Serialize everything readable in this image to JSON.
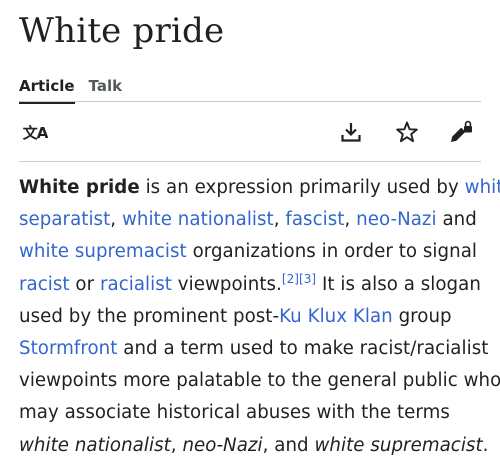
{
  "title": "White pride",
  "tabs": {
    "article": "Article",
    "talk": "Talk"
  },
  "colors": {
    "link": "#3366cc",
    "text": "#202122",
    "divider": "#c8ccd1"
  },
  "icons": [
    "language-icon",
    "download-icon",
    "star-icon",
    "edit-lock-icon"
  ],
  "language_glyph": "文A",
  "paragraph": {
    "bold_term": "White pride",
    "t1": " is an expression primarily used by ",
    "l_white_separatist_a": "white",
    "l_white_separatist_b": "separatist",
    "t2": ", ",
    "l_white_nationalist": "white nationalist",
    "t3": ", ",
    "l_fascist": "fascist",
    "t4": ", ",
    "l_neo_nazi": "neo-Nazi",
    "t5": " and",
    "l_white_supremacist": "white supremacist",
    "t6": " organizations in order to signal",
    "l_racist": "racist",
    "t7": " or ",
    "l_racialist": "racialist",
    "t8": " viewpoints.",
    "ref_2": "[2]",
    "ref_3": "[3]",
    "t9": " It is also a slogan",
    "t10": "used by the prominent post-",
    "l_kkk": "Ku Klux Klan",
    "t11": " group",
    "l_stormfront": "Stormfront",
    "t12": " and a term used to make racist/racialist",
    "t13": "viewpoints more palatable to the general public who",
    "t14": "may associate historical abuses with the terms",
    "i1": "white nationalist",
    "t15": ", ",
    "i2": "neo-Nazi",
    "t16": ", and ",
    "i3": "white supremacist",
    "t17": "."
  }
}
